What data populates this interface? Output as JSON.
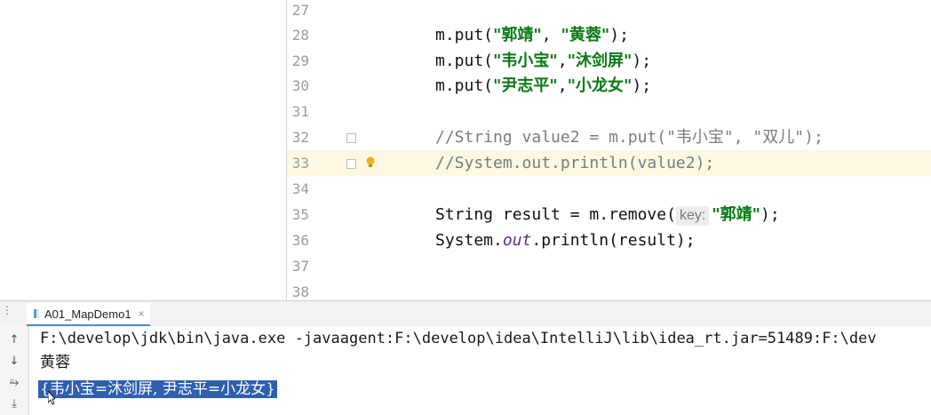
{
  "editor": {
    "lines": [
      {
        "num": "27"
      },
      {
        "num": "28",
        "code": {
          "pre": "m.put(",
          "s1": "\"郭靖\"",
          "mid": ", ",
          "s2": "\"黄蓉\"",
          "post": ");"
        }
      },
      {
        "num": "29",
        "code": {
          "pre": "m.put(",
          "s1": "\"韦小宝\"",
          "mid": ",",
          "s2": "\"沐剑屏\"",
          "post": ");"
        }
      },
      {
        "num": "30",
        "code": {
          "pre": "m.put(",
          "s1": "\"尹志平\"",
          "mid": ",",
          "s2": "\"小龙女\"",
          "post": ");"
        }
      },
      {
        "num": "31"
      },
      {
        "num": "32",
        "comment": "//String value2 = m.put(\"韦小宝\", \"双儿\");"
      },
      {
        "num": "33",
        "comment": "//System.out.println(value2);"
      },
      {
        "num": "34"
      },
      {
        "num": "35",
        "code35": {
          "pre": "String result = m.remove(",
          "hint": "key:",
          "s": "\"郭靖\"",
          "post": ");"
        }
      },
      {
        "num": "36",
        "code36": {
          "pre": "System.",
          "ital": "out",
          "post": ".println(result);"
        }
      },
      {
        "num": "37"
      },
      {
        "num": "38"
      }
    ],
    "current_line": "33"
  },
  "run": {
    "tab_label": "A01_MapDemo1",
    "tab_close": "×",
    "console": [
      "F:\\develop\\jdk\\bin\\java.exe -javaagent:F:\\develop\\idea\\IntelliJ\\lib\\idea_rt.jar=51489:F:\\dev",
      "黄蓉",
      "{韦小宝=沐剑屏, 尹志平=小龙女}"
    ],
    "side_buttons": [
      "arrow-up-icon",
      "arrow-down-icon",
      "soft-wrap-icon",
      "scroll-to-end-icon"
    ]
  },
  "colors": {
    "string": "#0a7a15",
    "comment": "#7c7c7c",
    "current_line": "#fcf8e1",
    "selection": "#2f5fae"
  }
}
